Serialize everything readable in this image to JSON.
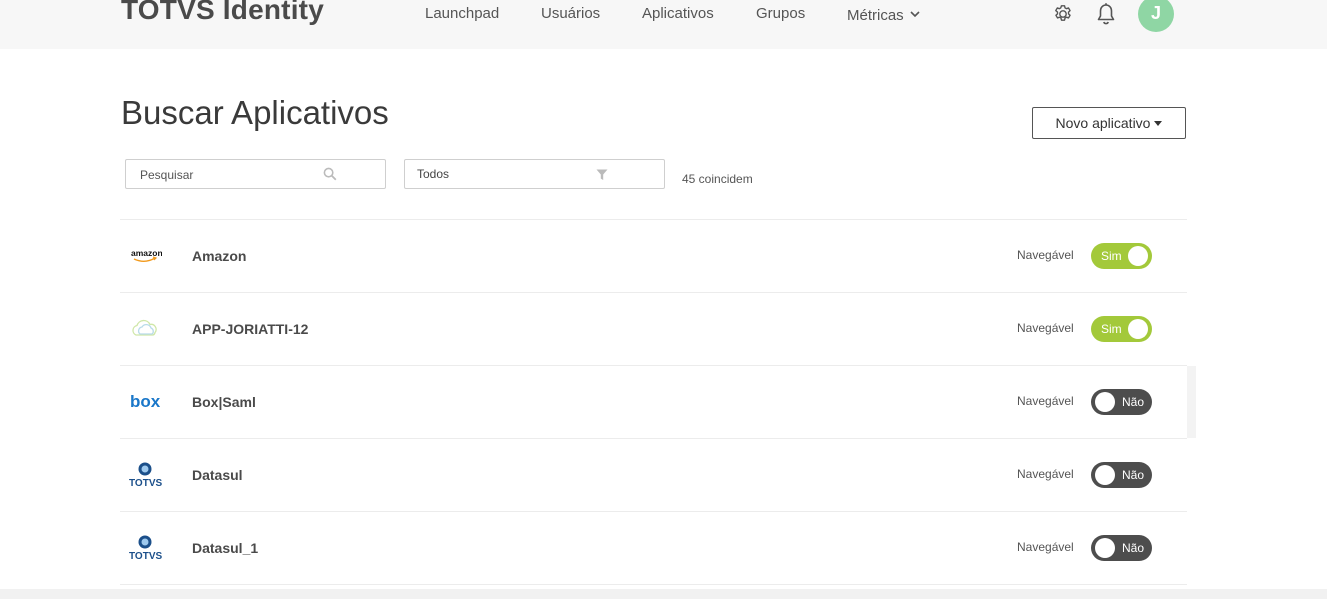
{
  "header": {
    "brand": "TOTVS Identity",
    "nav": [
      {
        "label": "Launchpad"
      },
      {
        "label": "Usuários"
      },
      {
        "label": "Aplicativos"
      },
      {
        "label": "Grupos"
      },
      {
        "label": "Métricas",
        "has_dropdown": true
      }
    ],
    "settings_icon": "gear-icon",
    "notifications_icon": "bell-icon",
    "avatar_initial": "J",
    "avatar_color": "#8fd6a4"
  },
  "page": {
    "title": "Buscar Aplicativos",
    "new_app_label": "Novo aplicativo"
  },
  "filters": {
    "search_placeholder": "Pesquisar",
    "search_value": "",
    "filter_value": "Todos",
    "match_count": "45 coincidem"
  },
  "apps": [
    {
      "name": "Amazon",
      "logo": "amazon-logo",
      "logo_text": "amazon",
      "navegavel_label": "Navegável",
      "navegavel": true,
      "toggle_label": "Sim"
    },
    {
      "name": "APP-JORIATTI-12",
      "logo": "cloud-logo",
      "navegavel_label": "Navegável",
      "navegavel": true,
      "toggle_label": "Sim"
    },
    {
      "name": "Box|Saml",
      "logo": "box-logo",
      "logo_text": "box",
      "navegavel_label": "Navegável",
      "navegavel": false,
      "toggle_label": "Não"
    },
    {
      "name": "Datasul",
      "logo": "totvs-logo",
      "logo_text": "TOTVS",
      "navegavel_label": "Navegável",
      "navegavel": false,
      "toggle_label": "Não"
    },
    {
      "name": "Datasul_1",
      "logo": "totvs-logo",
      "logo_text": "TOTVS",
      "navegavel_label": "Navegável",
      "navegavel": false,
      "toggle_label": "Não"
    }
  ],
  "colors": {
    "toggle_on": "#a3c93a",
    "toggle_off": "#4d4d4d",
    "box_blue": "#1a77c9",
    "totvs_blue": "#1b4f8a"
  }
}
